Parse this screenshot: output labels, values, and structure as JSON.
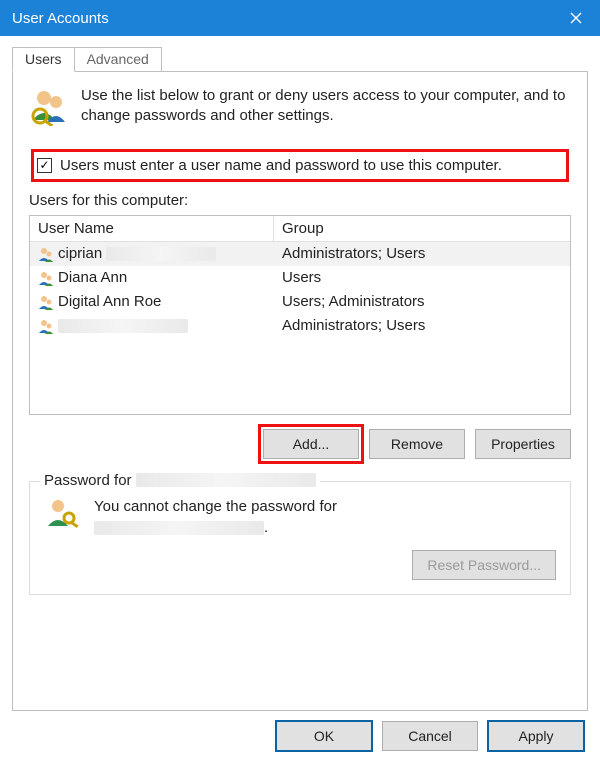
{
  "window": {
    "title": "User Accounts"
  },
  "tabs": {
    "users": "Users",
    "advanced": "Advanced"
  },
  "intro": "Use the list below to grant or deny users access to your computer, and to change passwords and other settings.",
  "checkbox": {
    "checked": true,
    "label": "Users must enter a user name and password to use this computer."
  },
  "list_label": "Users for this computer:",
  "columns": {
    "name": "User Name",
    "group": "Group"
  },
  "users": [
    {
      "name": "ciprian",
      "group": "Administrators; Users",
      "redacted_after_name": true,
      "selected": true
    },
    {
      "name": "Diana Ann",
      "group": "Users"
    },
    {
      "name": "Digital Ann Roe",
      "group": "Users; Administrators"
    },
    {
      "name": "",
      "group": "Administrators; Users",
      "redacted_name": true
    }
  ],
  "buttons": {
    "add": "Add...",
    "remove": "Remove",
    "properties": "Properties"
  },
  "password_box": {
    "legend_prefix": "Password for",
    "text_line1": "You cannot change the password for",
    "text_line2_suffix": ".",
    "reset": "Reset Password...",
    "reset_enabled": false
  },
  "dialog_buttons": {
    "ok": "OK",
    "cancel": "Cancel",
    "apply": "Apply"
  },
  "highlights": {
    "checkbox_row": true,
    "add_button": true
  }
}
